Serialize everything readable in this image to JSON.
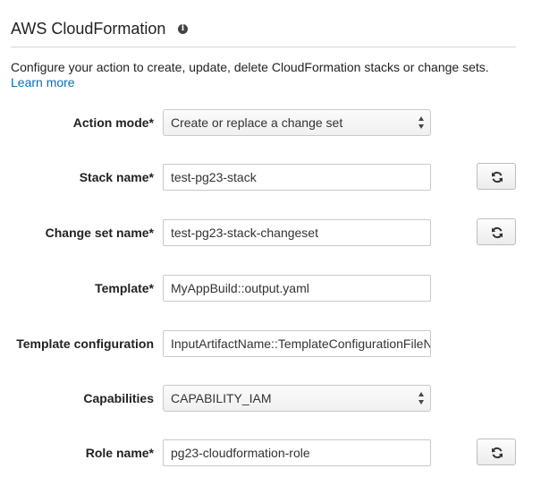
{
  "header": {
    "title": "AWS CloudFormation",
    "info_icon": "info-icon"
  },
  "description": {
    "text": "Configure your action to create, update, delete CloudFormation stacks or change sets.",
    "link": "Learn more"
  },
  "fields": {
    "action_mode": {
      "label": "Action mode*",
      "value": "Create or replace a change set"
    },
    "stack_name": {
      "label": "Stack name*",
      "value": "test-pg23-stack"
    },
    "change_set_name": {
      "label": "Change set name*",
      "value": "test-pg23-stack-changeset"
    },
    "template": {
      "label": "Template*",
      "value": "MyAppBuild::output.yaml"
    },
    "template_configuration": {
      "label": "Template configuration",
      "value": "InputArtifactName::TemplateConfigurationFileName"
    },
    "capabilities": {
      "label": "Capabilities",
      "value": "CAPABILITY_IAM"
    },
    "role_name": {
      "label": "Role name*",
      "value": "pg23-cloudformation-role"
    }
  },
  "icons": {
    "refresh": "refresh-icon",
    "select_arrows": "select-arrows-icon"
  }
}
